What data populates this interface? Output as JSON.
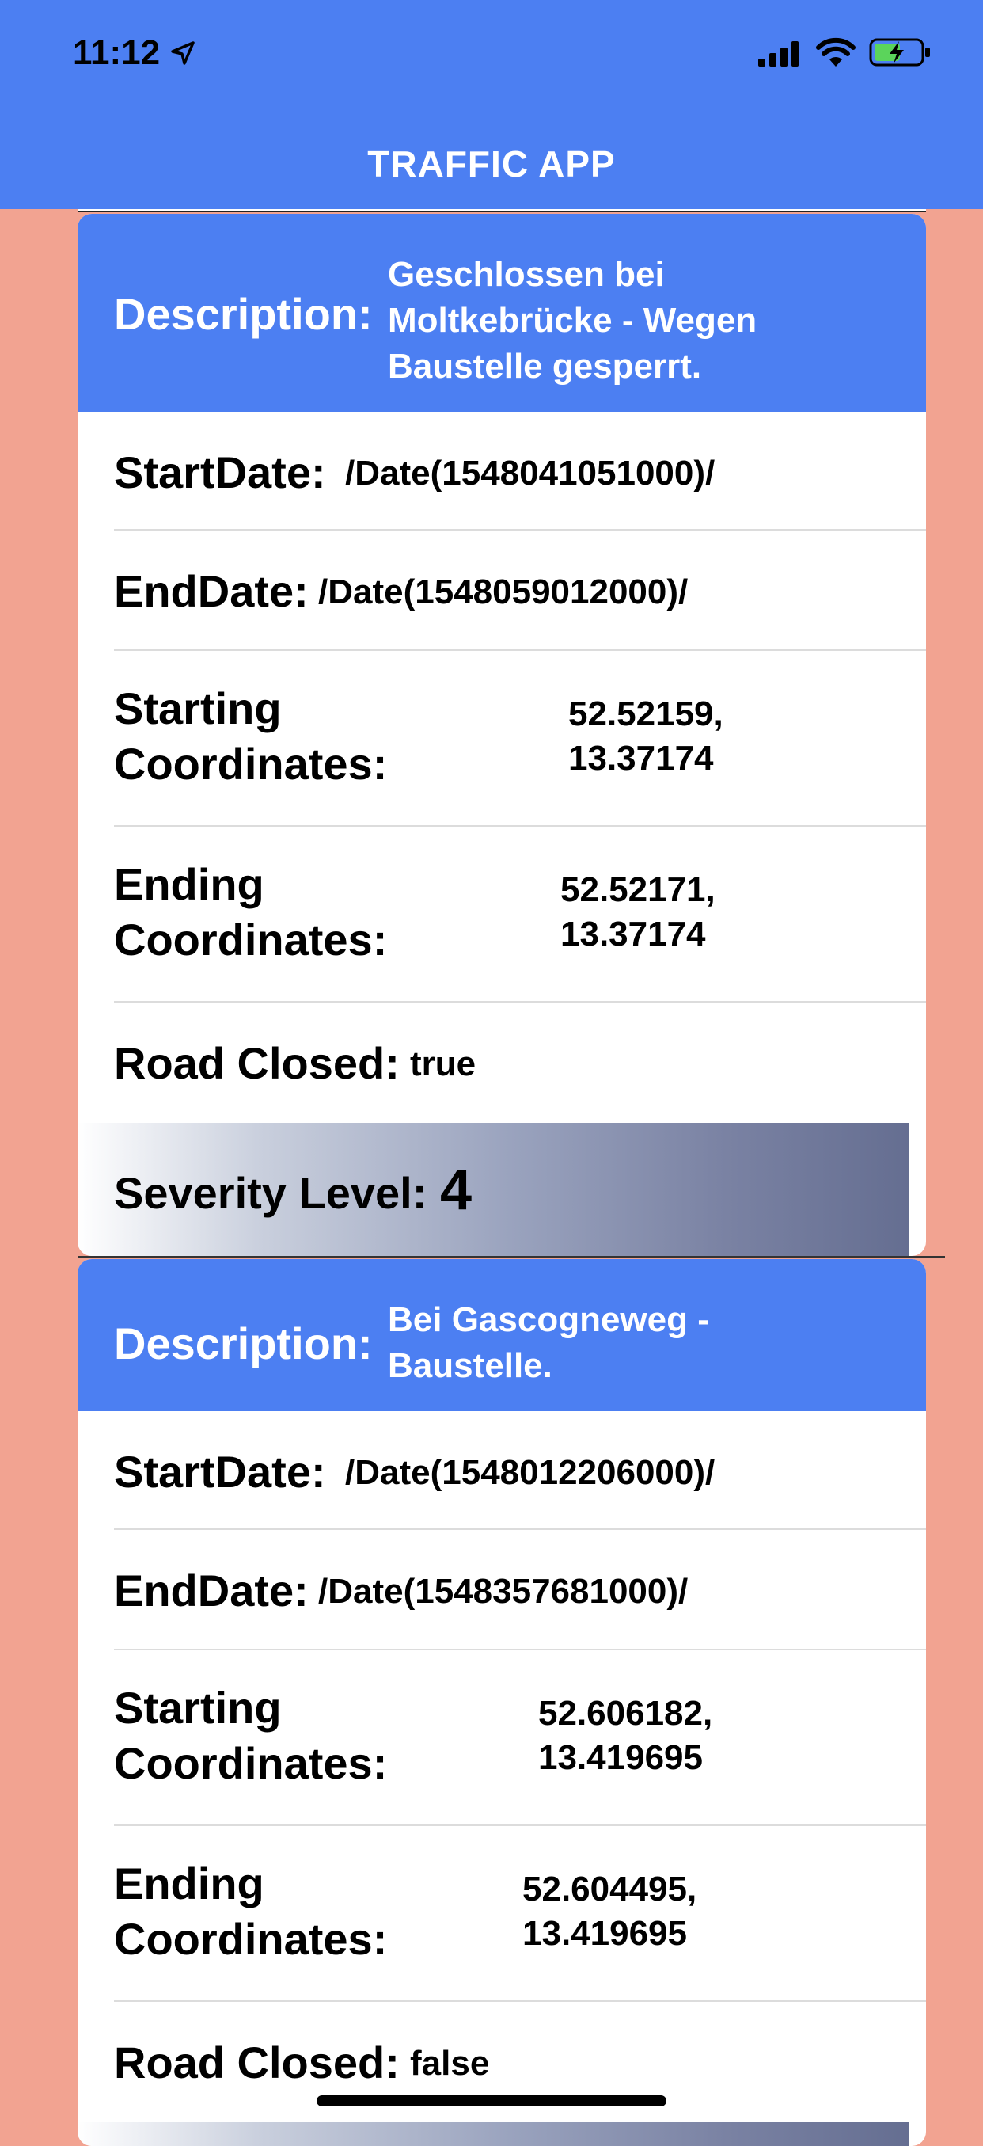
{
  "status_bar": {
    "time": "11:12"
  },
  "nav": {
    "title": "TRAFFIC APP"
  },
  "labels": {
    "description": "Description:",
    "start_date": "StartDate:",
    "end_date": "EndDate:",
    "starting_coordinates_line1": "Starting",
    "starting_coordinates_line2": "Coordinates:",
    "ending_coordinates_line1": "Ending",
    "ending_coordinates_line2": "Coordinates:",
    "road_closed": "Road Closed:",
    "severity_level": "Severity Level:"
  },
  "incidents": [
    {
      "description": "Geschlossen bei Moltkebrücke - Wegen Baustelle gesperrt.",
      "start_date": "/Date(1548041051000)/",
      "end_date": "/Date(1548059012000)/",
      "starting_coordinates": "52.52159, 13.37174",
      "ending_coordinates": "52.52171, 13.37174",
      "road_closed": "true",
      "severity_level": "4"
    },
    {
      "description": "Bei Gascogneweg - Baustelle.",
      "start_date": "/Date(1548012206000)/",
      "end_date": "/Date(1548357681000)/",
      "starting_coordinates": "52.606182, 13.419695",
      "ending_coordinates": "52.604495, 13.419695",
      "road_closed": "false"
    }
  ]
}
